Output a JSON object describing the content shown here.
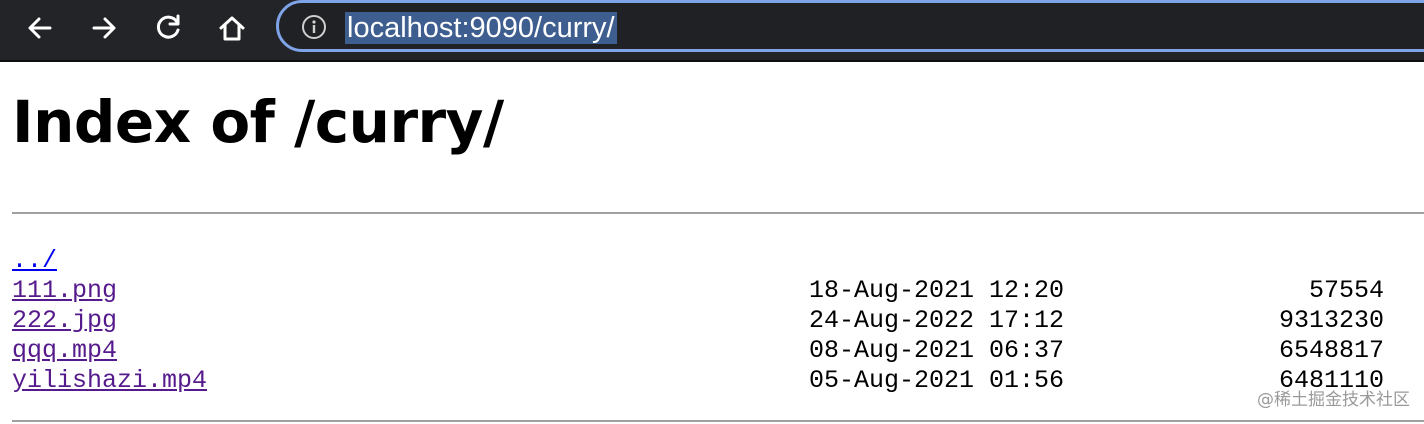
{
  "browser": {
    "url": "localhost:9090/curry/",
    "icons": {
      "back": "arrow-left-icon",
      "forward": "arrow-right-icon",
      "reload": "reload-icon",
      "home": "home-icon",
      "site_info": "info-icon"
    },
    "colors": {
      "toolbar": "#232427",
      "omnibox_border": "#7ea3e6",
      "url_selection": "#3d5e8f"
    }
  },
  "page": {
    "title": "Index of /curry/",
    "entries": [
      {
        "name": "../",
        "date": "",
        "size": ""
      },
      {
        "name": "111.png",
        "date": "18-Aug-2021 12:20",
        "size": "57554"
      },
      {
        "name": "222.jpg",
        "date": "24-Aug-2022 17:12",
        "size": "9313230"
      },
      {
        "name": "qqq.mp4",
        "date": "08-Aug-2021 06:37",
        "size": "6548817"
      },
      {
        "name": "yilishazi.mp4",
        "date": "05-Aug-2021 01:56",
        "size": "6481110"
      }
    ],
    "colors": {
      "link": "#0000ee",
      "visited_link": "#551a8b",
      "rule": "#a0a0a0"
    }
  },
  "watermark": "@稀土掘金技术社区"
}
